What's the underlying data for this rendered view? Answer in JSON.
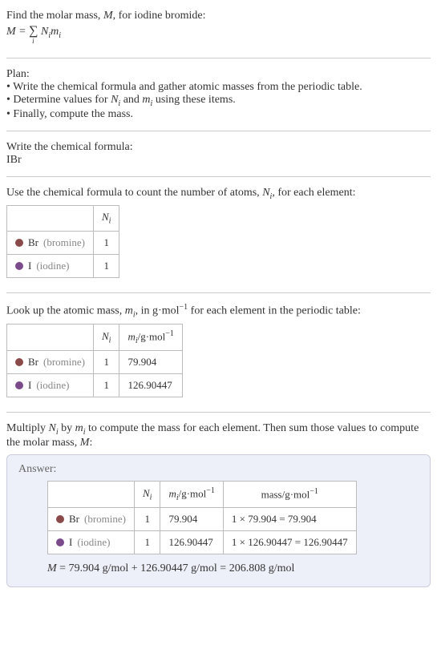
{
  "intro": {
    "line1_prefix": "Find the molar mass, ",
    "line1_var": "M",
    "line1_suffix": ", for iodine bromide:",
    "formula_left": "M = ",
    "formula_sigma": "∑",
    "formula_sigma_sub": "i",
    "formula_right1": " N",
    "formula_right1_sub": "i",
    "formula_right2": "m",
    "formula_right2_sub": "i"
  },
  "plan": {
    "heading": "Plan:",
    "bullet1": "• Write the chemical formula and gather atomic masses from the periodic table.",
    "bullet2_prefix": "• Determine values for ",
    "bullet2_n": "N",
    "bullet2_n_sub": "i",
    "bullet2_and": " and ",
    "bullet2_m": "m",
    "bullet2_m_sub": "i",
    "bullet2_suffix": " using these items.",
    "bullet3": "• Finally, compute the mass."
  },
  "chemformula": {
    "heading": "Write the chemical formula:",
    "value": "IBr"
  },
  "count": {
    "line_prefix": "Use the chemical formula to count the number of atoms, ",
    "line_var": "N",
    "line_var_sub": "i",
    "line_suffix": ", for each element:",
    "header_ni": "N",
    "header_ni_sub": "i",
    "rows": [
      {
        "dot": "dot-br",
        "symbol": "Br",
        "name": "(bromine)",
        "ni": "1"
      },
      {
        "dot": "dot-i",
        "symbol": "I",
        "name": "(iodine)",
        "ni": "1"
      }
    ]
  },
  "atomicmass": {
    "line_prefix": "Look up the atomic mass, ",
    "line_var": "m",
    "line_var_sub": "i",
    "line_mid": ", in g·mol",
    "line_sup": "−1",
    "line_suffix": " for each element in the periodic table:",
    "header_ni": "N",
    "header_ni_sub": "i",
    "header_mi": "m",
    "header_mi_sub": "i",
    "header_unit": "/g·mol",
    "header_unit_sup": "−1",
    "rows": [
      {
        "dot": "dot-br",
        "symbol": "Br",
        "name": "(bromine)",
        "ni": "1",
        "mi": "79.904"
      },
      {
        "dot": "dot-i",
        "symbol": "I",
        "name": "(iodine)",
        "ni": "1",
        "mi": "126.90447"
      }
    ]
  },
  "multiply": {
    "prefix": "Multiply ",
    "n": "N",
    "n_sub": "i",
    "by": " by ",
    "m": "m",
    "m_sub": "i",
    "mid": " to compute the mass for each element. Then sum those values to compute the molar mass, ",
    "mvar": "M",
    "suffix": ":"
  },
  "answer": {
    "label": "Answer:",
    "header_ni": "N",
    "header_ni_sub": "i",
    "header_mi": "m",
    "header_mi_sub": "i",
    "header_mi_unit": "/g·mol",
    "header_mi_unit_sup": "−1",
    "header_mass": "mass/g·mol",
    "header_mass_sup": "−1",
    "rows": [
      {
        "dot": "dot-br",
        "symbol": "Br",
        "name": "(bromine)",
        "ni": "1",
        "mi": "79.904",
        "mass": "1 × 79.904 = 79.904"
      },
      {
        "dot": "dot-i",
        "symbol": "I",
        "name": "(iodine)",
        "ni": "1",
        "mi": "126.90447",
        "mass": "1 × 126.90447 = 126.90447"
      }
    ],
    "molar_var": "M",
    "molar_eq": " = 79.904 g/mol + 126.90447 g/mol = 206.808 g/mol"
  }
}
